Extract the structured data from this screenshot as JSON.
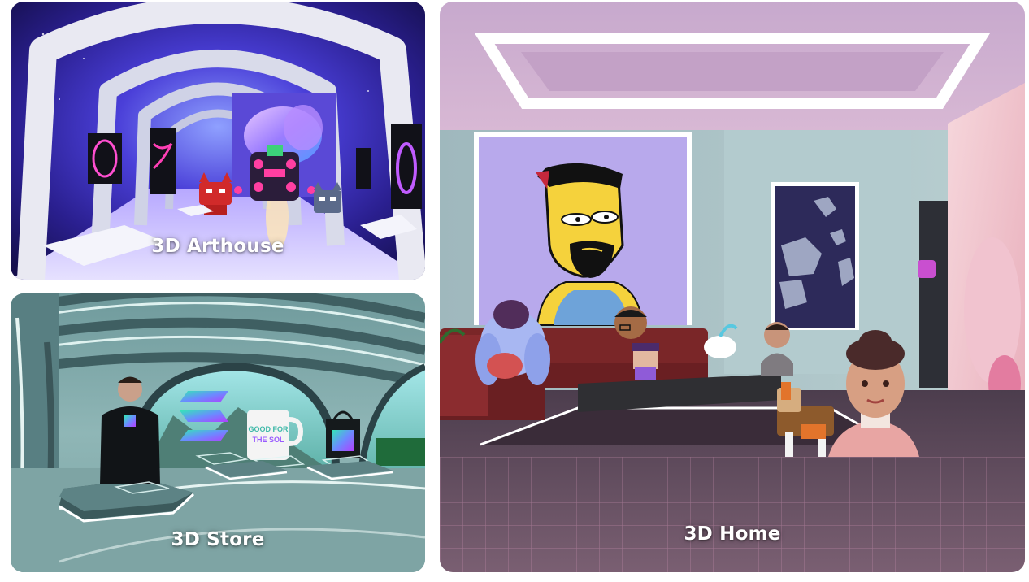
{
  "tiles": {
    "arthouse": {
      "label": "3D Arthouse"
    },
    "store": {
      "label": "3D Store",
      "mug_text_line1": "GOOD FOR",
      "mug_text_line2": "THE SOL"
    },
    "home": {
      "label": "3D Home"
    }
  }
}
